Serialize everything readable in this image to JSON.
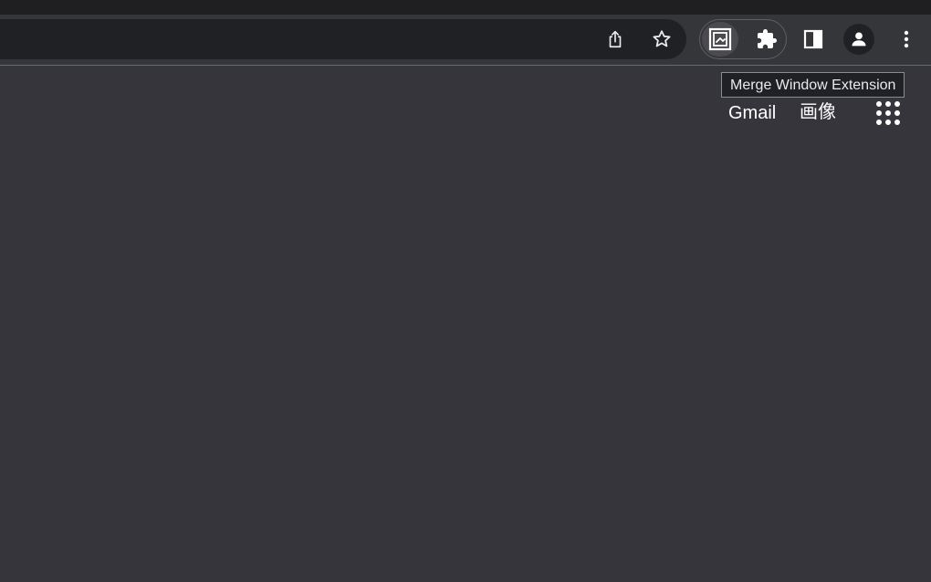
{
  "browser": {
    "toolbar": {
      "icons": {
        "share": "share-icon",
        "bookmark": "star-icon",
        "merge_window_extension": "merge-window-icon",
        "extensions": "puzzle-icon",
        "side_panel": "side-panel-icon",
        "profile": "profile-icon",
        "menu": "more-vert-icon"
      }
    },
    "tooltip": {
      "text": "Merge Window Extension"
    }
  },
  "page": {
    "links": {
      "gmail": "Gmail",
      "images": "画像"
    },
    "apps_icon": "apps-grid-icon"
  },
  "colors": {
    "page_background": "#35353b",
    "toolbar_background": "#35363a",
    "omnibox_background": "#202124",
    "icon_color": "#e8eaed"
  }
}
